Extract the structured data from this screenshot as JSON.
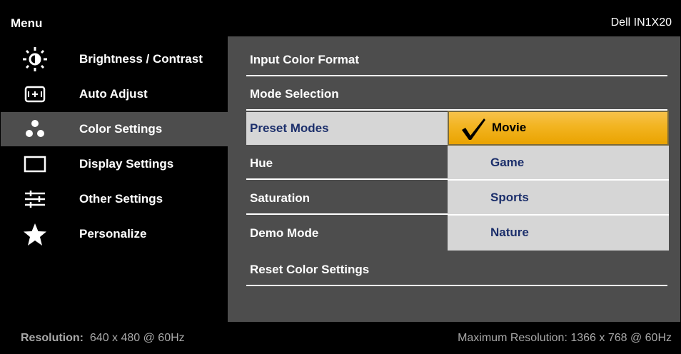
{
  "header": {
    "title": "Menu",
    "model": "Dell IN1X20"
  },
  "main_menu": {
    "items": [
      {
        "label": "Brightness / Contrast",
        "icon": "brightness-icon",
        "selected": false
      },
      {
        "label": "Auto Adjust",
        "icon": "auto-adjust-icon",
        "selected": false
      },
      {
        "label": "Color Settings",
        "icon": "color-dots-icon",
        "selected": true
      },
      {
        "label": "Display Settings",
        "icon": "display-rect-icon",
        "selected": false
      },
      {
        "label": "Other Settings",
        "icon": "sliders-icon",
        "selected": false
      },
      {
        "label": "Personalize",
        "icon": "star-icon",
        "selected": false
      }
    ]
  },
  "color_settings": {
    "items": [
      {
        "label": "Input Color Format"
      },
      {
        "label": "Mode Selection"
      },
      {
        "label": "Preset Modes",
        "active": true
      },
      {
        "label": "Hue"
      },
      {
        "label": "Saturation"
      },
      {
        "label": "Demo Mode"
      },
      {
        "label": "Reset Color Settings"
      }
    ]
  },
  "preset_modes": {
    "selected": "Movie",
    "options": [
      "Movie",
      "Game",
      "Sports",
      "Nature"
    ]
  },
  "footer": {
    "resolution_key": "Resolution:",
    "resolution_value": "640 x 480 @ 60Hz",
    "max_resolution": "Maximum Resolution: 1366 x 768 @ 60Hz"
  },
  "colors": {
    "highlight": "#f2b421",
    "panel_grey": "#4d4d4d",
    "option_bg": "#d6d6d6",
    "option_text": "#1c2f6b"
  }
}
